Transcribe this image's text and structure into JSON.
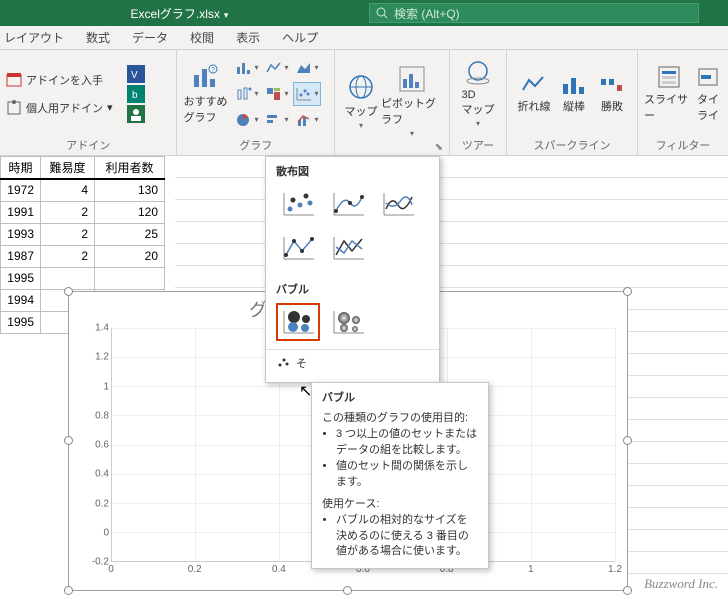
{
  "title": {
    "filename": "Excelグラフ.xlsx"
  },
  "search": {
    "placeholder": "検索 (Alt+Q)"
  },
  "tabs": [
    "レイアウト",
    "数式",
    "データ",
    "校閲",
    "表示",
    "ヘルプ"
  ],
  "groups": {
    "addins": {
      "get": "アドインを入手",
      "my": "個人用アドイン",
      "label": "アドイン"
    },
    "recommended": {
      "label": "おすすめ\nグラフ"
    },
    "charts": {
      "label": "グラフ"
    },
    "map": {
      "label": "マップ"
    },
    "pivot": {
      "label": "ピボットグラフ"
    },
    "tour": {
      "threed": "3D\nマップ",
      "label": "ツアー"
    },
    "sparklines": {
      "line": "折れ線",
      "column": "縦棒",
      "winloss": "勝敗",
      "label": "スパークライン"
    },
    "filter": {
      "slicer": "スライサー",
      "timeline": "タイ\nライ",
      "label": "フィルター"
    }
  },
  "table": {
    "headers": [
      "時期",
      "難易度",
      "利用者数"
    ],
    "rows": [
      [
        "1972",
        "4",
        "130"
      ],
      [
        "1991",
        "2",
        "120"
      ],
      [
        "1993",
        "2",
        "25"
      ],
      [
        "1987",
        "2",
        "20"
      ],
      [
        "1995",
        "",
        ""
      ],
      [
        "1994",
        "",
        ""
      ],
      [
        "1995",
        "",
        ""
      ]
    ]
  },
  "dropdown": {
    "scatter_label": "散布図",
    "bubble_label": "バブル",
    "more_scatter": "そ"
  },
  "tooltip": {
    "title": "バブル",
    "purpose_label": "この種類のグラフの使用目的:",
    "purpose1": "3 つ以上の値のセットまたはデータの組を比較します。",
    "purpose2": "値のセット間の関係を示します。",
    "usecase_label": "使用ケース:",
    "usecase1": "バブルの相対的なサイズを決めるのに使える 3 番目の値がある場合に使います。"
  },
  "chart_data": {
    "type": "scatter",
    "title": "グ",
    "xlabel": "",
    "ylabel": "",
    "xlim": [
      0,
      1.2
    ],
    "ylim": [
      -0.2,
      1.4
    ],
    "xticks": [
      0,
      0.2,
      0.4,
      0.6,
      0.8,
      1,
      1.2
    ],
    "yticks": [
      -0.2,
      0,
      0.2,
      0.4,
      0.6,
      0.8,
      1,
      1.2,
      1.4
    ],
    "series": []
  },
  "watermark": "Buzzword Inc."
}
